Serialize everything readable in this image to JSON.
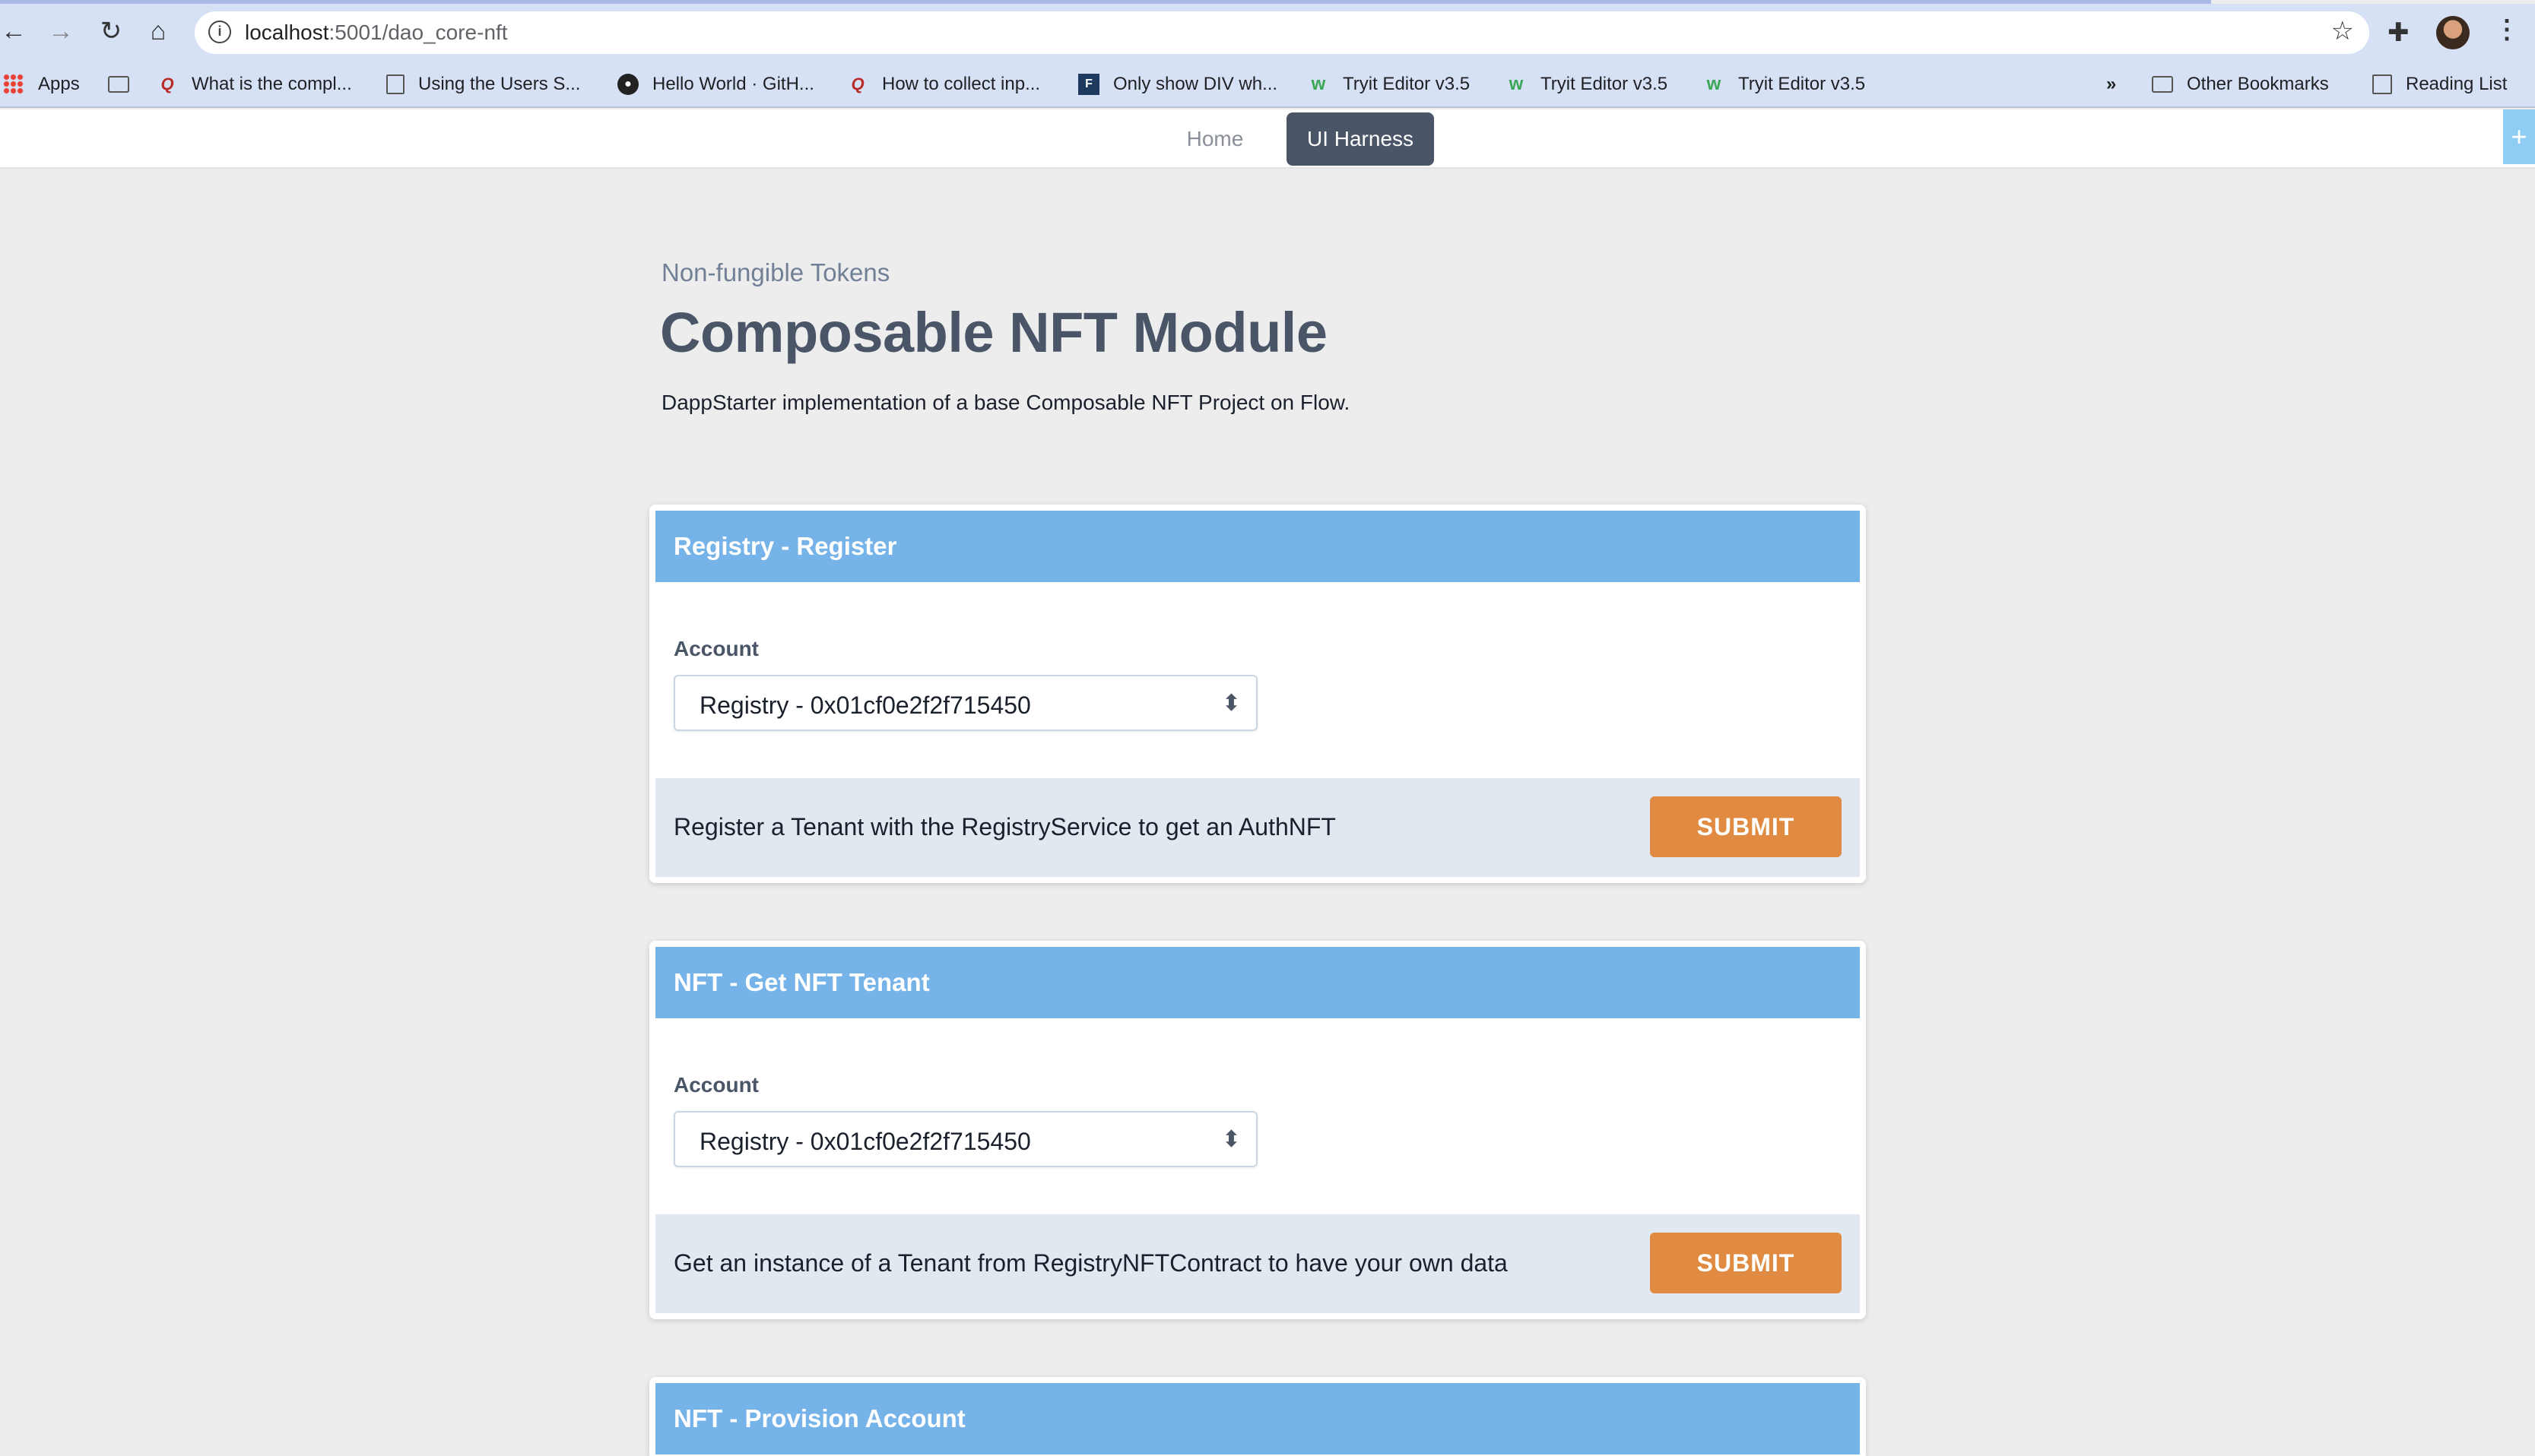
{
  "browser": {
    "url_host": "localhost",
    "url_path": ":5001/dao_core-nft",
    "bookmarks": [
      {
        "label": "Apps",
        "icon": "apps-grid-icon"
      },
      {
        "label": "",
        "icon": "folder-icon"
      },
      {
        "label": "What is the compl...",
        "icon": "quora-icon"
      },
      {
        "label": "Using the Users S...",
        "icon": "document-icon"
      },
      {
        "label": "Hello World · GitH...",
        "icon": "github-icon"
      },
      {
        "label": "How to collect inp...",
        "icon": "quora-icon"
      },
      {
        "label": "Only show DIV wh...",
        "icon": "f-icon"
      },
      {
        "label": "Tryit Editor v3.5",
        "icon": "w3schools-icon"
      },
      {
        "label": "Tryit Editor v3.5",
        "icon": "w3schools-icon"
      },
      {
        "label": "Tryit Editor v3.5",
        "icon": "w3schools-icon"
      }
    ],
    "overflow": "»",
    "other_bookmarks": "Other Bookmarks",
    "reading_list": "Reading List"
  },
  "nav": {
    "home": "Home",
    "ui_harness": "UI Harness",
    "side_plus": "+"
  },
  "header": {
    "eyebrow": "Non-fungible Tokens",
    "title": "Composable NFT Module",
    "subtitle": "DappStarter implementation of a base Composable NFT Project on Flow."
  },
  "cards": [
    {
      "title": "Registry - Register",
      "account_label": "Account",
      "account_value": "Registry - 0x01cf0e2f2f715450",
      "description": "Register a Tenant with the RegistryService to get an AuthNFT",
      "submit": "SUBMIT"
    },
    {
      "title": "NFT - Get NFT Tenant",
      "account_label": "Account",
      "account_value": "Registry - 0x01cf0e2f2f715450",
      "description": "Get an instance of a Tenant from RegistryNFTContract to have your own data",
      "submit": "SUBMIT"
    },
    {
      "title": "NFT - Provision Account"
    }
  ],
  "colors": {
    "card_header": "#76b3e8",
    "submit": "#e08b41",
    "active_tab": "#4a5568"
  }
}
